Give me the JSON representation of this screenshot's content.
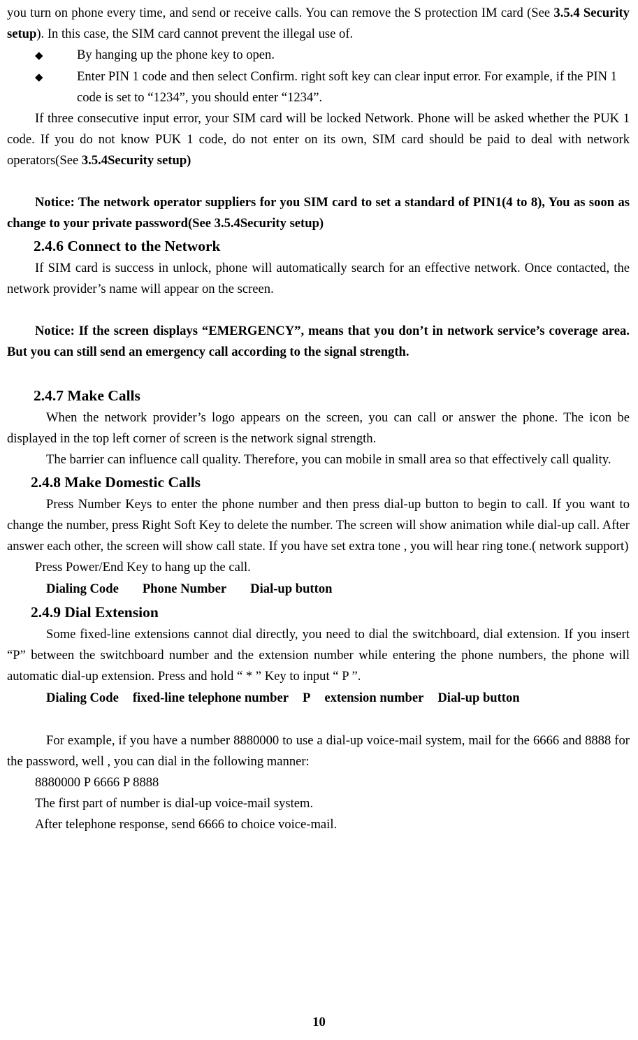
{
  "document": {
    "page_number": "10",
    "paragraphs": {
      "p1_part1": "you turn on phone every time, and send or receive calls. You can remove the S protection IM card (See ",
      "p1_bold": "3.5.4 Security setup",
      "p1_part2": "). In this case, the SIM card cannot prevent the illegal use of.",
      "bullet1": "By hanging up the phone key to open.",
      "bullet2": "Enter PIN 1 code and then select Confirm. right soft key can clear input error. For example, if the PIN 1 code is set to “1234”, you should enter “1234”.",
      "p2_part1": "If three consecutive input error, your SIM card will be locked Network. Phone will be asked whether the PUK 1 code. If you do not know PUK 1 code, do not enter on its own, SIM card should be paid to deal with network operators(See ",
      "p2_bold": "3.5.4Security setup)",
      "notice1_bold": "Notice: The network operator suppliers for you SIM card to set a standard of PIN1(4 to 8), You as soon as change to your private password(",
      "notice1_normal": "See ",
      "notice1_bold2": "3.5.4Security setup)",
      "heading_246": "2.4.6 Connect to the Network",
      "p3": "If SIM card is success in unlock, phone will automatically search for an effective network. Once contacted, the network provider’s name will appear on the screen.",
      "notice2": "Notice: If the screen displays “EMERGENCY”, means that you don’t in network service’s coverage area. But you can still send an emergency call according to the signal strength.",
      "heading_247": "2.4.7 Make Calls",
      "p4": "When the network provider’s logo appears on the screen, you can call or answer the phone. The icon be displayed in the top left corner of screen is the network signal strength.",
      "p5": "The barrier can influence call quality. Therefore, you can mobile in small area so that effectively call quality.",
      "heading_248": "2.4.8 Make Domestic Calls",
      "p6": "Press Number Keys to enter the phone number and then press dial-up button to begin to call. If you want to change the number, press Right Soft Key to delete the number. The screen will show animation while dial-up call. After answer each other, the screen will show call state. If you have set extra tone ,    you will hear ring tone.( network support)",
      "p7": "Press Power/End Key to hang up the call.",
      "dial_row1_a": "Dialing Code",
      "dial_row1_b": "Phone Number",
      "dial_row1_c": "Dial-up button",
      "heading_249": "2.4.9 Dial Extension",
      "p8": "Some fixed-line extensions cannot dial directly, you need to dial the switchboard, dial extension. If you insert “P” between the switchboard number and the extension number while entering the phone numbers, the phone will automatic dial-up extension. Press and hold “ * ”    Key to input “ P ”.",
      "dial_row2_a": "Dialing Code",
      "dial_row2_b": "fixed-line telephone number",
      "dial_row2_c": "P",
      "dial_row2_d": "extension number",
      "dial_row2_e": "Dial-up button",
      "p9": "For example, if you have a number 8880000 to use a dial-up voice-mail system, mail for the 6666 and 8888 for the password, well , you can dial in the following manner:",
      "p10": "8880000 P 6666 P 8888",
      "p11": "The first part of number is dial-up voice-mail system.",
      "p12": "After telephone response, send 6666 to choice voice-mail."
    },
    "icons": {
      "diamond_bullet": "◆"
    }
  }
}
